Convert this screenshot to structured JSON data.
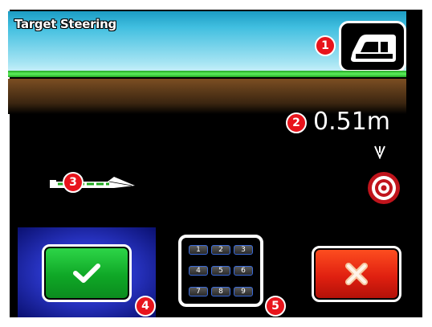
{
  "header": {
    "title": "Target Steering"
  },
  "callouts": [
    "1",
    "2",
    "3",
    "4",
    "5"
  ],
  "distance": {
    "value": "0.51m"
  },
  "keypad": {
    "keys": [
      "1",
      "2",
      "3",
      "4",
      "5",
      "6",
      "7",
      "8",
      "9"
    ]
  },
  "colors": {
    "header_top": "#1c9cc4",
    "header_bottom": "#d6f4fb",
    "guidance_line": "#3cd83c",
    "ok_button": "#12b02a",
    "cancel_button": "#e82810",
    "target": "#c0141c",
    "badge": "#e8141c"
  },
  "icons": {
    "vehicle": "vehicle-icon",
    "implement": "implement-icon",
    "target": "target-icon",
    "arrow": "arrow-down-icon",
    "ok": "checkmark-icon",
    "cancel": "x-icon"
  }
}
